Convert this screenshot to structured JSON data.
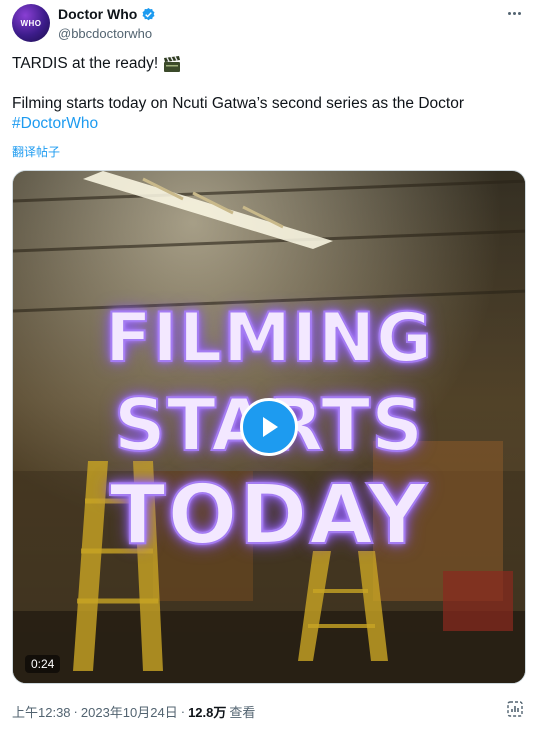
{
  "author": {
    "name": "Doctor Who",
    "handle": "@bbcdoctorwho",
    "avatar_text": "WHO"
  },
  "tweet": {
    "line1": "TARDIS at the ready!",
    "line2": "Filming starts today on Ncuti Gatwa’s second series as the Doctor",
    "hashtag": "#DoctorWho",
    "translate": "翻译帖子"
  },
  "media": {
    "overlay_line1": "FILMING",
    "overlay_line2": "STARTS",
    "overlay_line3": "TODAY",
    "duration": "0:24"
  },
  "meta": {
    "time": "上午12:38",
    "date": "2023年10月24日",
    "views": "12.8万",
    "views_label": "查看",
    "separator": "·"
  },
  "colors": {
    "accent": "#1d9bf0",
    "text": "#0f1419",
    "secondary": "#536471",
    "glow": "#b98cff"
  },
  "icons": {
    "verified": "verified-badge-icon",
    "clapper": "clapper-board-icon",
    "play": "play-icon",
    "more": "more-icon",
    "stats": "stats-icon"
  }
}
